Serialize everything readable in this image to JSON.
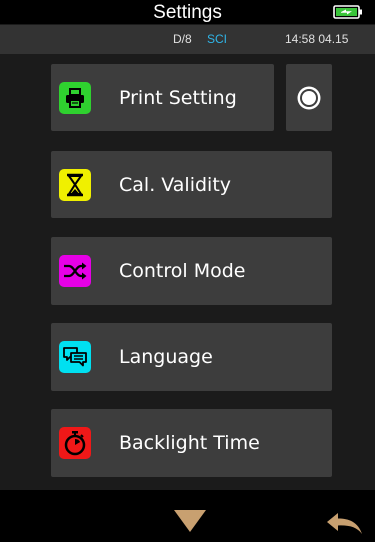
{
  "header": {
    "title": "Settings",
    "battery_icon": "battery-charging-icon"
  },
  "status": {
    "mode": "D/8",
    "spec": "SCI",
    "time": "14:58 04.15"
  },
  "menu": [
    {
      "label": "Print Setting",
      "icon": "printer-icon",
      "color": "#2fd12f"
    },
    {
      "label": "Cal. Validity",
      "icon": "hourglass-icon",
      "color": "#f0f000"
    },
    {
      "label": "Control Mode",
      "icon": "shuffle-icon",
      "color": "#e600e6"
    },
    {
      "label": "Language",
      "icon": "chat-bubbles-icon",
      "color": "#00e0f0"
    },
    {
      "label": "Backlight Time",
      "icon": "stopwatch-icon",
      "color": "#f01818"
    }
  ],
  "print_toggle": {
    "icon": "radio-icon",
    "selected": true
  },
  "footer": {
    "down_icon": "down-arrow-icon",
    "back_icon": "back-arrow-icon",
    "arrow_color": "#c8a070"
  }
}
